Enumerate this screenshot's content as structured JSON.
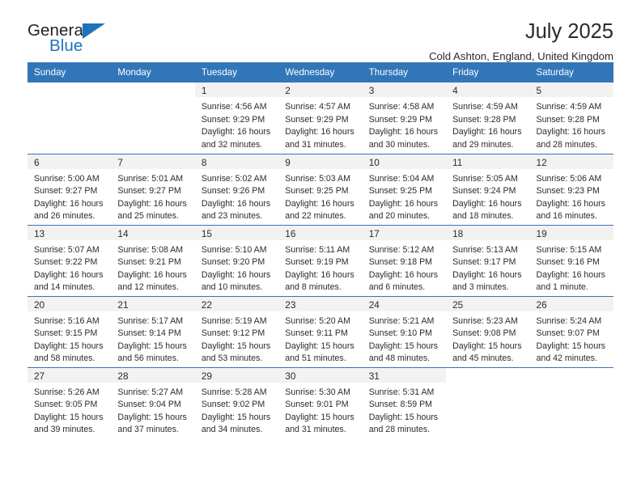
{
  "brand": {
    "name_primary": "General",
    "name_secondary": "Blue",
    "triangle_color": "#1d74bd"
  },
  "header": {
    "title": "July 2025",
    "subtitle": "Cold Ashton, England, United Kingdom"
  },
  "colors": {
    "header_blue": "#3176b8",
    "day_band_gray": "#f2f2f2",
    "text": "#2b2b2b"
  },
  "calendar": {
    "weekday_headers": [
      "Sunday",
      "Monday",
      "Tuesday",
      "Wednesday",
      "Thursday",
      "Friday",
      "Saturday"
    ],
    "weeks": [
      [
        {
          "day": "",
          "empty": true
        },
        {
          "day": "",
          "empty": true
        },
        {
          "day": "1",
          "sunrise": "Sunrise: 4:56 AM",
          "sunset": "Sunset: 9:29 PM",
          "daylight_1": "Daylight: 16 hours",
          "daylight_2": "and 32 minutes."
        },
        {
          "day": "2",
          "sunrise": "Sunrise: 4:57 AM",
          "sunset": "Sunset: 9:29 PM",
          "daylight_1": "Daylight: 16 hours",
          "daylight_2": "and 31 minutes."
        },
        {
          "day": "3",
          "sunrise": "Sunrise: 4:58 AM",
          "sunset": "Sunset: 9:29 PM",
          "daylight_1": "Daylight: 16 hours",
          "daylight_2": "and 30 minutes."
        },
        {
          "day": "4",
          "sunrise": "Sunrise: 4:59 AM",
          "sunset": "Sunset: 9:28 PM",
          "daylight_1": "Daylight: 16 hours",
          "daylight_2": "and 29 minutes."
        },
        {
          "day": "5",
          "sunrise": "Sunrise: 4:59 AM",
          "sunset": "Sunset: 9:28 PM",
          "daylight_1": "Daylight: 16 hours",
          "daylight_2": "and 28 minutes."
        }
      ],
      [
        {
          "day": "6",
          "sunrise": "Sunrise: 5:00 AM",
          "sunset": "Sunset: 9:27 PM",
          "daylight_1": "Daylight: 16 hours",
          "daylight_2": "and 26 minutes."
        },
        {
          "day": "7",
          "sunrise": "Sunrise: 5:01 AM",
          "sunset": "Sunset: 9:27 PM",
          "daylight_1": "Daylight: 16 hours",
          "daylight_2": "and 25 minutes."
        },
        {
          "day": "8",
          "sunrise": "Sunrise: 5:02 AM",
          "sunset": "Sunset: 9:26 PM",
          "daylight_1": "Daylight: 16 hours",
          "daylight_2": "and 23 minutes."
        },
        {
          "day": "9",
          "sunrise": "Sunrise: 5:03 AM",
          "sunset": "Sunset: 9:25 PM",
          "daylight_1": "Daylight: 16 hours",
          "daylight_2": "and 22 minutes."
        },
        {
          "day": "10",
          "sunrise": "Sunrise: 5:04 AM",
          "sunset": "Sunset: 9:25 PM",
          "daylight_1": "Daylight: 16 hours",
          "daylight_2": "and 20 minutes."
        },
        {
          "day": "11",
          "sunrise": "Sunrise: 5:05 AM",
          "sunset": "Sunset: 9:24 PM",
          "daylight_1": "Daylight: 16 hours",
          "daylight_2": "and 18 minutes."
        },
        {
          "day": "12",
          "sunrise": "Sunrise: 5:06 AM",
          "sunset": "Sunset: 9:23 PM",
          "daylight_1": "Daylight: 16 hours",
          "daylight_2": "and 16 minutes."
        }
      ],
      [
        {
          "day": "13",
          "sunrise": "Sunrise: 5:07 AM",
          "sunset": "Sunset: 9:22 PM",
          "daylight_1": "Daylight: 16 hours",
          "daylight_2": "and 14 minutes."
        },
        {
          "day": "14",
          "sunrise": "Sunrise: 5:08 AM",
          "sunset": "Sunset: 9:21 PM",
          "daylight_1": "Daylight: 16 hours",
          "daylight_2": "and 12 minutes."
        },
        {
          "day": "15",
          "sunrise": "Sunrise: 5:10 AM",
          "sunset": "Sunset: 9:20 PM",
          "daylight_1": "Daylight: 16 hours",
          "daylight_2": "and 10 minutes."
        },
        {
          "day": "16",
          "sunrise": "Sunrise: 5:11 AM",
          "sunset": "Sunset: 9:19 PM",
          "daylight_1": "Daylight: 16 hours",
          "daylight_2": "and 8 minutes."
        },
        {
          "day": "17",
          "sunrise": "Sunrise: 5:12 AM",
          "sunset": "Sunset: 9:18 PM",
          "daylight_1": "Daylight: 16 hours",
          "daylight_2": "and 6 minutes."
        },
        {
          "day": "18",
          "sunrise": "Sunrise: 5:13 AM",
          "sunset": "Sunset: 9:17 PM",
          "daylight_1": "Daylight: 16 hours",
          "daylight_2": "and 3 minutes."
        },
        {
          "day": "19",
          "sunrise": "Sunrise: 5:15 AM",
          "sunset": "Sunset: 9:16 PM",
          "daylight_1": "Daylight: 16 hours",
          "daylight_2": "and 1 minute."
        }
      ],
      [
        {
          "day": "20",
          "sunrise": "Sunrise: 5:16 AM",
          "sunset": "Sunset: 9:15 PM",
          "daylight_1": "Daylight: 15 hours",
          "daylight_2": "and 58 minutes."
        },
        {
          "day": "21",
          "sunrise": "Sunrise: 5:17 AM",
          "sunset": "Sunset: 9:14 PM",
          "daylight_1": "Daylight: 15 hours",
          "daylight_2": "and 56 minutes."
        },
        {
          "day": "22",
          "sunrise": "Sunrise: 5:19 AM",
          "sunset": "Sunset: 9:12 PM",
          "daylight_1": "Daylight: 15 hours",
          "daylight_2": "and 53 minutes."
        },
        {
          "day": "23",
          "sunrise": "Sunrise: 5:20 AM",
          "sunset": "Sunset: 9:11 PM",
          "daylight_1": "Daylight: 15 hours",
          "daylight_2": "and 51 minutes."
        },
        {
          "day": "24",
          "sunrise": "Sunrise: 5:21 AM",
          "sunset": "Sunset: 9:10 PM",
          "daylight_1": "Daylight: 15 hours",
          "daylight_2": "and 48 minutes."
        },
        {
          "day": "25",
          "sunrise": "Sunrise: 5:23 AM",
          "sunset": "Sunset: 9:08 PM",
          "daylight_1": "Daylight: 15 hours",
          "daylight_2": "and 45 minutes."
        },
        {
          "day": "26",
          "sunrise": "Sunrise: 5:24 AM",
          "sunset": "Sunset: 9:07 PM",
          "daylight_1": "Daylight: 15 hours",
          "daylight_2": "and 42 minutes."
        }
      ],
      [
        {
          "day": "27",
          "sunrise": "Sunrise: 5:26 AM",
          "sunset": "Sunset: 9:05 PM",
          "daylight_1": "Daylight: 15 hours",
          "daylight_2": "and 39 minutes."
        },
        {
          "day": "28",
          "sunrise": "Sunrise: 5:27 AM",
          "sunset": "Sunset: 9:04 PM",
          "daylight_1": "Daylight: 15 hours",
          "daylight_2": "and 37 minutes."
        },
        {
          "day": "29",
          "sunrise": "Sunrise: 5:28 AM",
          "sunset": "Sunset: 9:02 PM",
          "daylight_1": "Daylight: 15 hours",
          "daylight_2": "and 34 minutes."
        },
        {
          "day": "30",
          "sunrise": "Sunrise: 5:30 AM",
          "sunset": "Sunset: 9:01 PM",
          "daylight_1": "Daylight: 15 hours",
          "daylight_2": "and 31 minutes."
        },
        {
          "day": "31",
          "sunrise": "Sunrise: 5:31 AM",
          "sunset": "Sunset: 8:59 PM",
          "daylight_1": "Daylight: 15 hours",
          "daylight_2": "and 28 minutes."
        },
        {
          "day": "",
          "empty": true
        },
        {
          "day": "",
          "empty": true
        }
      ]
    ]
  }
}
